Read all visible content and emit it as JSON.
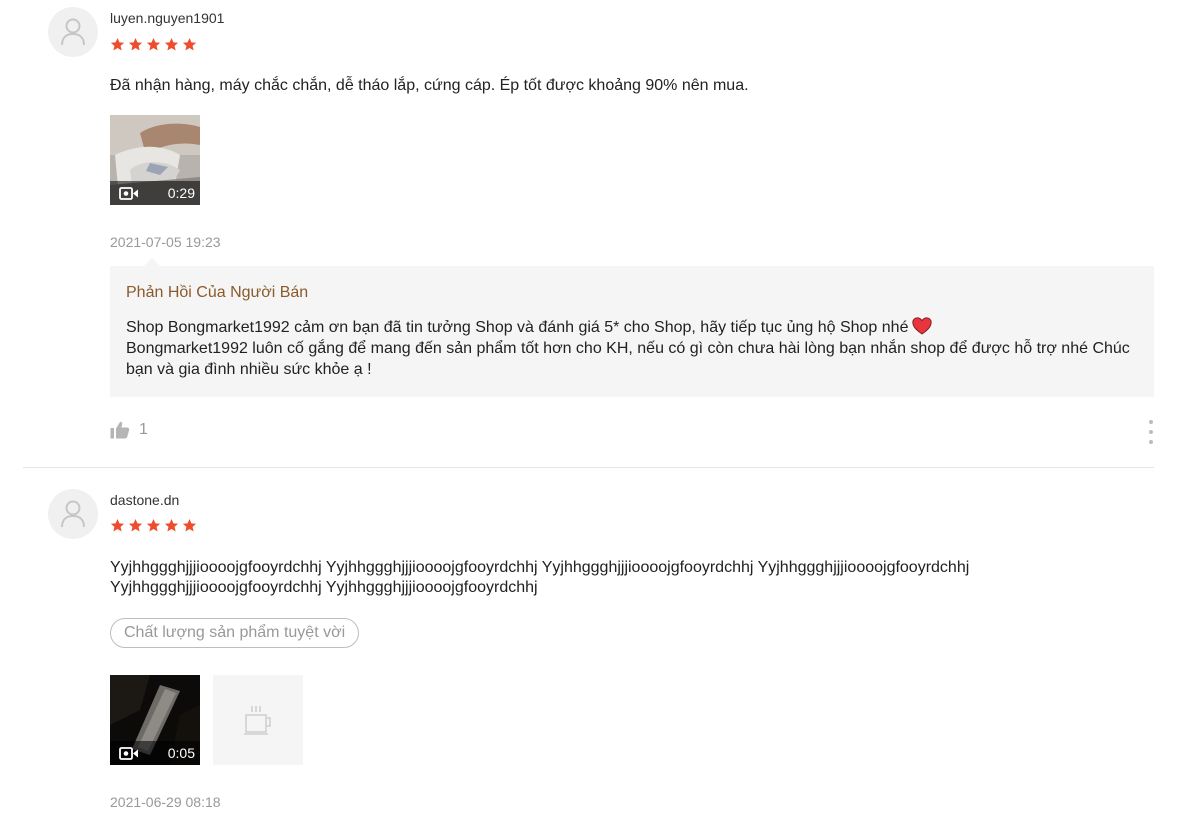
{
  "reviews": [
    {
      "username": "luyen.nguyen1901",
      "rating": 5,
      "comment": "Đã nhận hàng, máy chắc chắn, dễ tháo lắp, cứng cáp. Ép tốt được khoảng 90% nên mua.",
      "video_duration": "0:29",
      "timestamp": "2021-07-05 19:23",
      "seller_reply": {
        "title": "Phản Hồi Của Người Bán",
        "line1": "Shop Bongmarket1992 cảm ơn bạn đã tin tưởng Shop và đánh giá 5* cho Shop, hãy tiếp tục ủng hộ Shop nhé",
        "line2": "Bongmarket1992 luôn cố gắng để mang đến sản phẩm tốt hơn cho KH, nếu có gì còn chưa hài lòng bạn nhắn shop để được hỗ trợ nhé Chúc bạn và gia đình nhiều sức khỏe ạ !"
      },
      "likes": "1"
    },
    {
      "username": "dastone.dn",
      "rating": 5,
      "comment": "Yyjhhggghjjjioooojgfooyrdchhj Yyjhhggghjjjioooojgfooyrdchhj Yyjhhggghjjjioooojgfooyrdchhj Yyjhhggghjjjioooojgfooyrdchhj Yyjhhggghjjjioooojgfooyrdchhj Yyjhhggghjjjioooojgfooyrdchhj",
      "tag": "Chất lượng sản phẩm tuyệt vời",
      "video_duration": "0:05",
      "timestamp": "2021-06-29 08:18"
    }
  ],
  "colors": {
    "star": "#ee4d2d",
    "reply_title": "#8b5a2b",
    "reply_bg": "#f5f5f5",
    "muted": "#999999"
  },
  "icons": {
    "avatar": "user-silhouette-icon",
    "star": "star-icon",
    "video": "video-camera-icon",
    "heart": "heart-icon",
    "like": "thumbs-up-icon",
    "more": "vertical-ellipsis-icon",
    "placeholder": "coffee-cup-icon"
  }
}
